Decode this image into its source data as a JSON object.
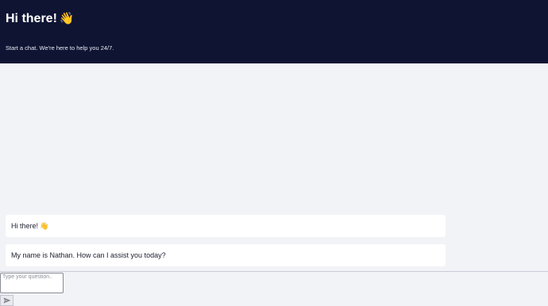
{
  "header": {
    "title": "Hi there!",
    "title_emoji": "👋",
    "subtitle": "Start a chat. We're here to help you 24/7."
  },
  "messages": [
    {
      "text": "Hi there!",
      "emoji": "👋"
    },
    {
      "text": "My name is Nathan. How can I assist you today?"
    }
  ],
  "composer": {
    "placeholder": "Type your question..",
    "send_icon": "send-icon"
  },
  "colors": {
    "header_bg": "#0f1433",
    "page_bg": "#f2f3f7",
    "bubble_bg": "#ffffff"
  }
}
